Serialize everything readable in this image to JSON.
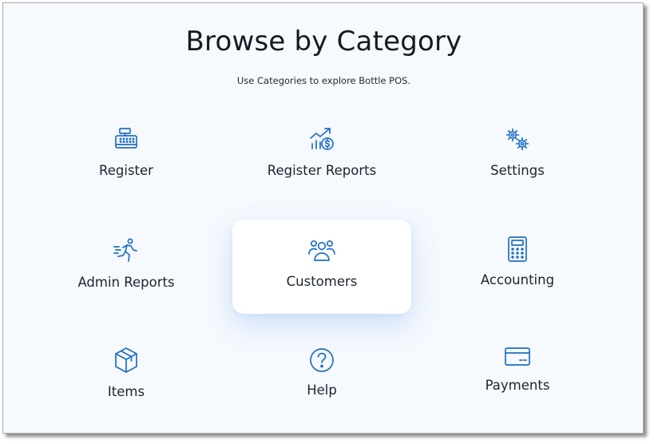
{
  "header": {
    "title": "Browse by Category",
    "subtitle": "Use Categories to explore Bottle POS."
  },
  "categories": [
    {
      "label": "Register",
      "icon": "cash-register-icon"
    },
    {
      "label": "Register Reports",
      "icon": "chart-growth-dollar-icon"
    },
    {
      "label": "Settings",
      "icon": "gears-icon"
    },
    {
      "label": "Admin Reports",
      "icon": "running-person-icon"
    },
    {
      "label": "Customers",
      "icon": "users-group-icon"
    },
    {
      "label": "Accounting",
      "icon": "calculator-icon"
    },
    {
      "label": "Items",
      "icon": "box-icon"
    },
    {
      "label": "Help",
      "icon": "question-circle-icon"
    },
    {
      "label": "Payments",
      "icon": "credit-card-icon"
    }
  ],
  "colors": {
    "icon": "#1e6fc3",
    "text": "#1c2430",
    "background": "#f6f9fe"
  }
}
